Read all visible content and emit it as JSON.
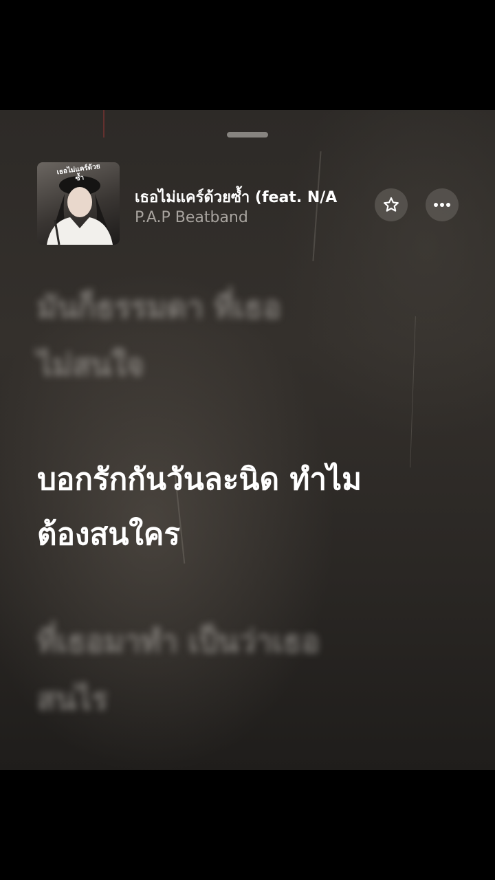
{
  "now_playing": {
    "title": "เธอไม่แคร์ด้วยซ้ำ (feat. N/A",
    "artist": "P.A.P Beatband",
    "artwork_text": "เธอไม่แคร์ด้วยซ้ำ"
  },
  "lyrics": {
    "previous": [
      "มันก็ธรรมดา ที่เธอ",
      "ไม่สนใจ"
    ],
    "current": [
      "บอกรักกันวันละนิด ทำไม",
      "ต้องสนใคร"
    ],
    "next": [
      "ที่เธอมาทำ เป็นว่าเธอ",
      "สนไร"
    ],
    "after": ""
  },
  "icons": {
    "favorite": "star-icon",
    "more": "more-horizontal-icon"
  },
  "colors": {
    "background": "#2d2a27",
    "lyric_active": "#ffffff",
    "lyric_inactive": "#bebab4"
  }
}
